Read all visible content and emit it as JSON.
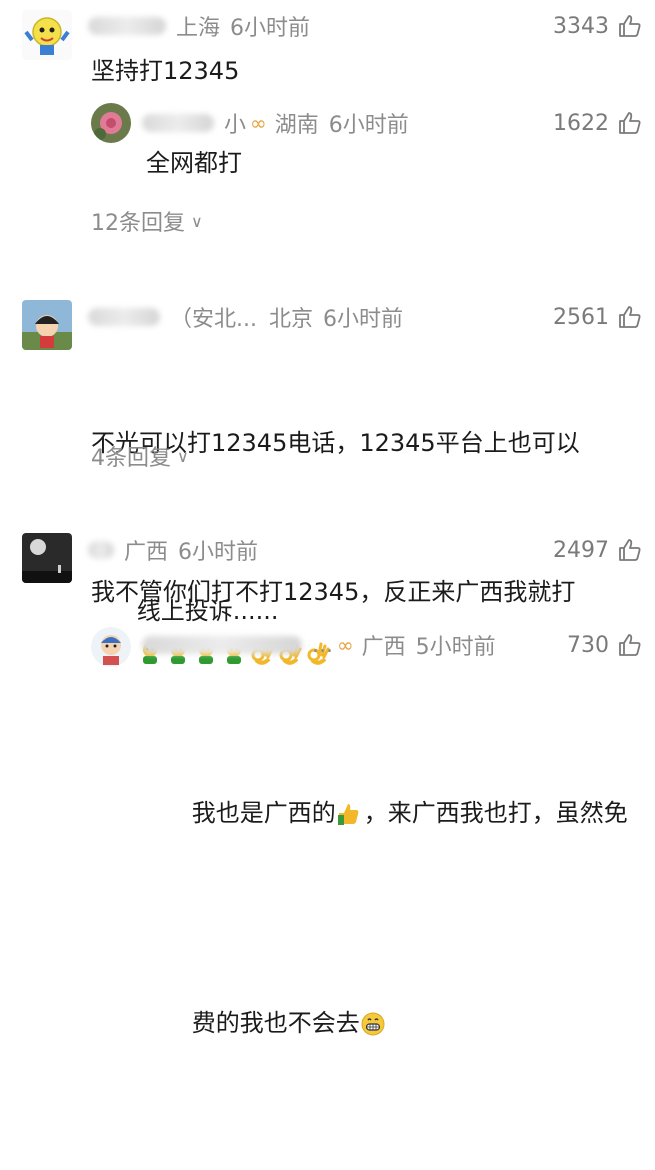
{
  "comments": [
    {
      "location": "上海",
      "time": "6小时前",
      "likes": "3343",
      "text": "坚持打12345",
      "reply": {
        "name_tail": "小",
        "location": "湖南",
        "time": "6小时前",
        "likes": "1622",
        "text": "全网都打"
      },
      "replies_label": "12条回复"
    },
    {
      "name_suffix": "（安北...",
      "location": "北京",
      "time": "6小时前",
      "likes": "2561",
      "text_line1": "不光可以打12345电话，12345平台上也可以",
      "text_line2": "线上投诉......",
      "replies_label": "4条回复"
    },
    {
      "location": "广西",
      "time": "6小时前",
      "likes": "2497",
      "text": "我不管你们打不打12345，反正来广西我就打",
      "reply": {
        "name_tail": "...",
        "location": "广西",
        "time": "5小时前",
        "likes": "730",
        "text_line1": "我也是广西的",
        "text_line1b": "，来广西我也打，虽然免",
        "text_line2": "费的我也不会去"
      }
    }
  ],
  "icons": {
    "like": "thumbs-up-icon",
    "badge": "vip-badge-icon",
    "chevron": "chevron-down-icon"
  },
  "chevron_glyph": "∨",
  "colors": {
    "meta": "#8c8c8c",
    "badge": "#e8a33d",
    "text": "#1b1b1b"
  }
}
